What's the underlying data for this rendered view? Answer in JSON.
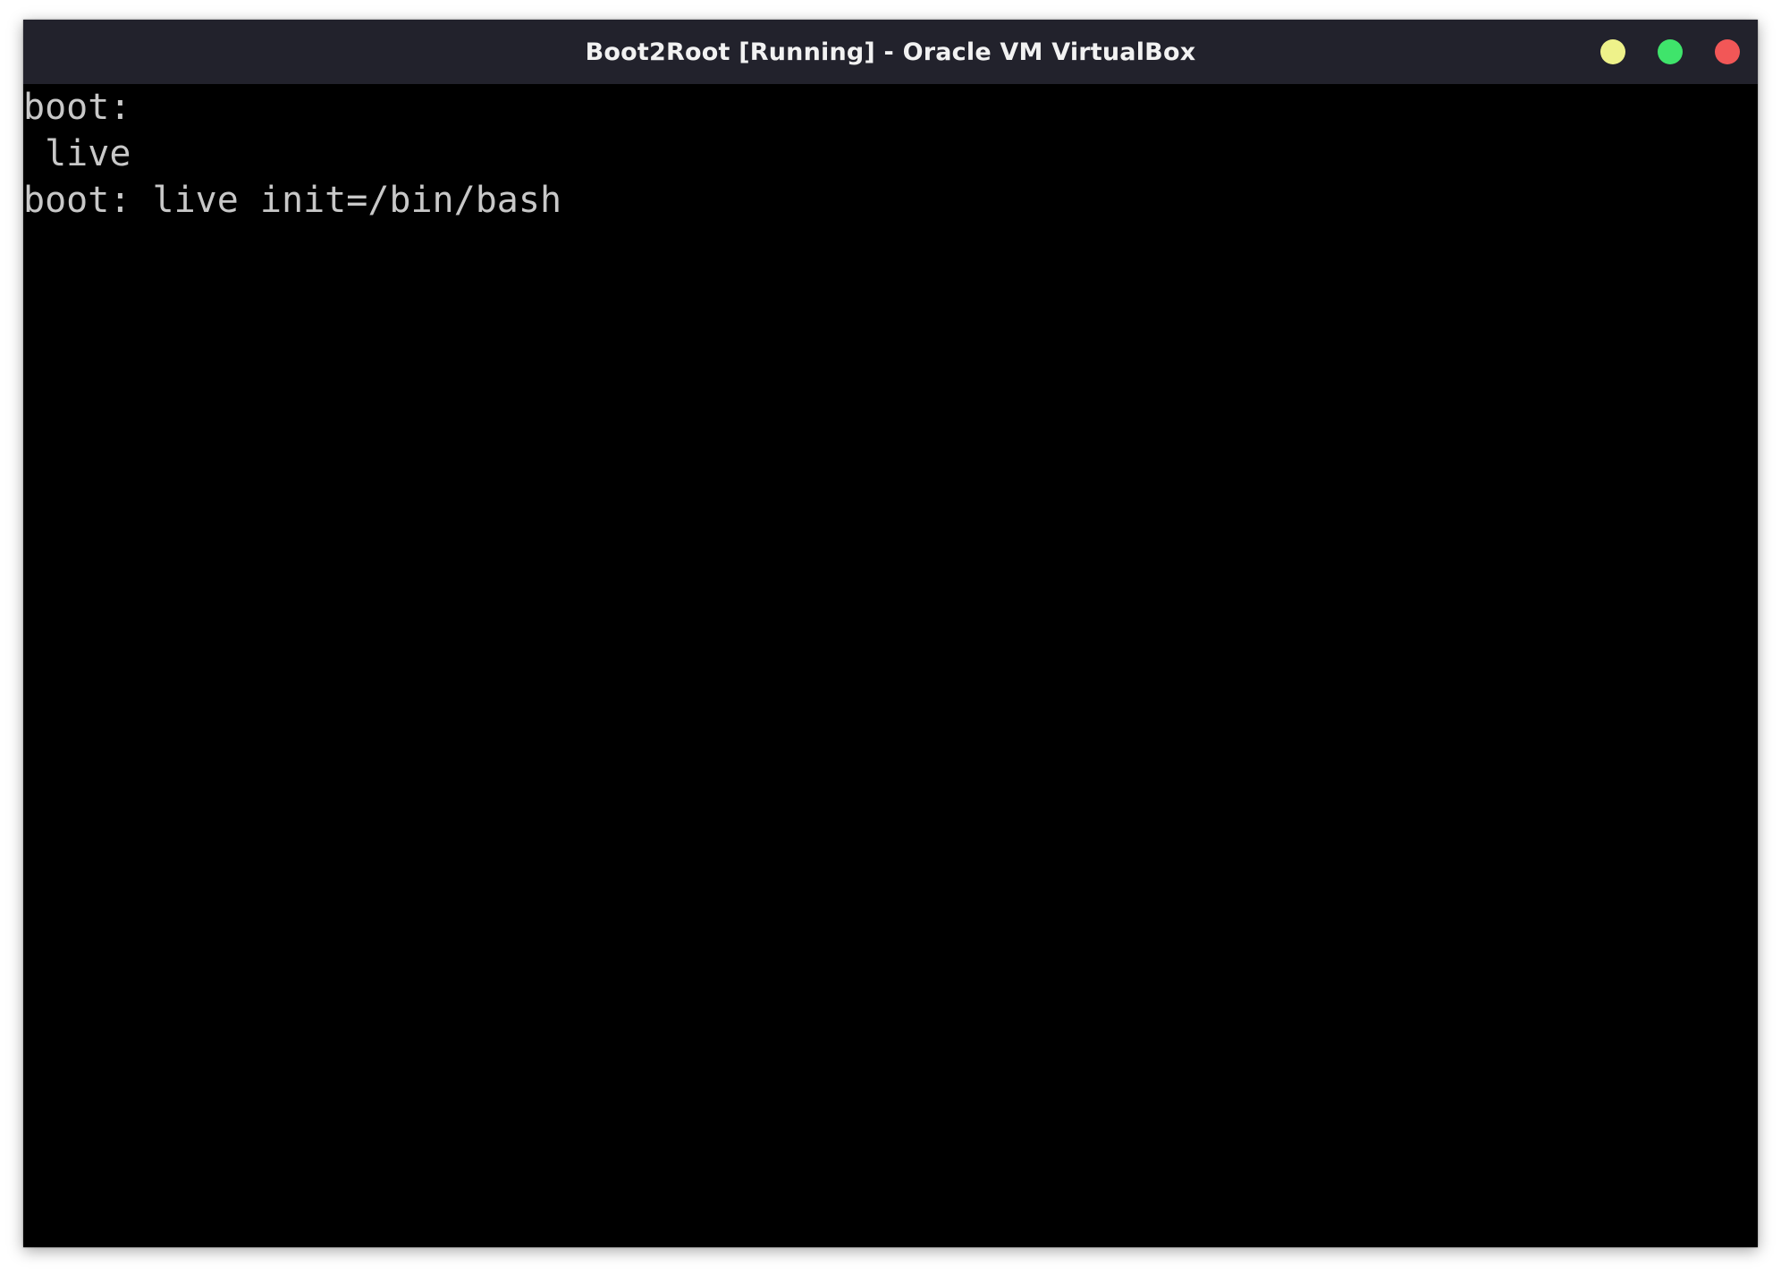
{
  "window": {
    "title": "Boot2Root [Running] - Oracle VM VirtualBox",
    "controls": [
      {
        "name": "minimize",
        "color": "#eef28a"
      },
      {
        "name": "maximize",
        "color": "#3fe46b"
      },
      {
        "name": "close",
        "color": "#f25757"
      }
    ]
  },
  "console": {
    "lines": [
      "boot:",
      " live",
      "boot: live init=/bin/bash"
    ]
  }
}
